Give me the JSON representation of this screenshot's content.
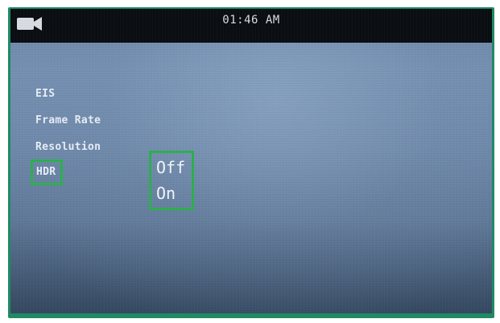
{
  "status_bar": {
    "mode_icon": "video-camera-icon",
    "time": "01:46 AM"
  },
  "settings_menu": {
    "items": [
      {
        "label": "EIS"
      },
      {
        "label": "Frame Rate"
      },
      {
        "label": "Resolution"
      },
      {
        "label": "HDR",
        "selected": true
      }
    ]
  },
  "hdr_options": {
    "items": [
      {
        "label": "Off"
      },
      {
        "label": "On"
      }
    ]
  },
  "colors": {
    "frame": "#1f8a63",
    "highlight": "#2db04f",
    "status_bar": "#0a0d12",
    "screen": "#6d86a8"
  }
}
